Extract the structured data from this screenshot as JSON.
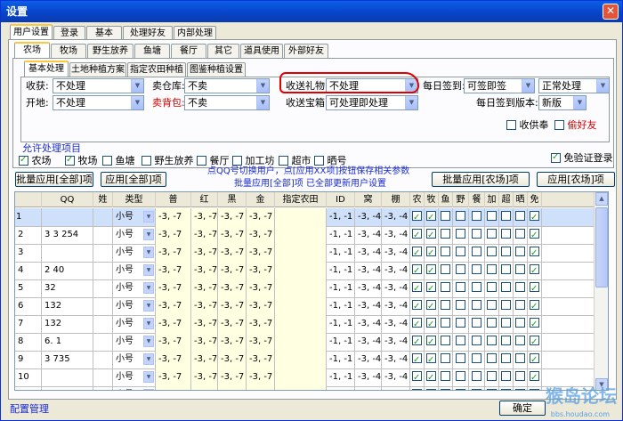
{
  "window": {
    "title": "设置",
    "close": "✕"
  },
  "main_tabs": [
    "用户设置",
    "登录",
    "基本",
    "处理好友",
    "内部处理"
  ],
  "sub_tabs": [
    "农场",
    "牧场",
    "野生放养",
    "鱼塘",
    "餐厅",
    "其它",
    "道具使用",
    "外部好友"
  ],
  "inner_tabs": [
    "基本处理",
    "土地种植方案",
    "指定农田种植",
    "图鉴种植设置"
  ],
  "form": {
    "harvest": {
      "label": "收获:",
      "value": "不处理"
    },
    "warehouse_sell": {
      "label": "卖仓库:",
      "value": "不卖"
    },
    "gift": {
      "label": "收送礼物:",
      "value": "不处理"
    },
    "daily_sign": {
      "label": "每日签到:",
      "value": "可签即签"
    },
    "normal": {
      "value": "正常处理"
    },
    "open_land": {
      "label": "开地:",
      "value": "不处理"
    },
    "bag_sell": {
      "label": "卖背包:",
      "value": "不卖"
    },
    "treasure": {
      "label": "收送宝箱:",
      "value": "可处理即处理"
    },
    "sign_version": {
      "label": "每日签到版本:",
      "value": "新版"
    },
    "collect_fist": {
      "label": "收供奉",
      "checked": false
    },
    "steal_friend": {
      "label": "偷好友",
      "checked": false
    }
  },
  "allow": {
    "title": "允许处理项目",
    "items": [
      {
        "label": "农场",
        "checked": true
      },
      {
        "label": "牧场",
        "checked": true
      },
      {
        "label": "鱼塘",
        "checked": false
      },
      {
        "label": "野生放养",
        "checked": false
      },
      {
        "label": "餐厅",
        "checked": false
      },
      {
        "label": "加工坊",
        "checked": false
      },
      {
        "label": "超市",
        "checked": false
      },
      {
        "label": "晒号",
        "checked": false
      }
    ],
    "free_verify": {
      "label": "免验证登录",
      "checked": true
    }
  },
  "hint1": "点QQ号切换用户，点[应用XX项]按钮保存相关参数",
  "hint2": "批量应用[全部]项 已全部更新用户设置",
  "buttons": {
    "batch_all": "批量应用[全部]项",
    "apply_all": "应用[全部]项",
    "batch_farm": "批量应用[农场]项",
    "apply_farm": "应用[农场]项",
    "ok": "确定"
  },
  "table": {
    "headers": [
      "QQ",
      "姓",
      "类型",
      "普",
      "红",
      "黑",
      "金",
      "指定农田",
      "ID",
      "窝",
      "棚",
      "农",
      "牧",
      "鱼",
      "野",
      "餐",
      "加",
      "超",
      "晒",
      "免"
    ],
    "rows": [
      {
        "n": "1",
        "qq": "",
        "type": "小号",
        "v": "-3, -7",
        "id": "-1, -1",
        "w": "-3, -4",
        "c": "-3, -4",
        "cur": true
      },
      {
        "n": "2",
        "qq": "3  3  254",
        "type": "小号",
        "v": "-3, -7",
        "id": "-1, -1",
        "w": "-3, -4",
        "c": "-3, -4"
      },
      {
        "n": "3",
        "qq": "",
        "type": "小号",
        "v": "-3, -7",
        "id": "-1, -1",
        "w": "-3, -4",
        "c": "-3, -4"
      },
      {
        "n": "4",
        "qq": "2 40",
        "type": "小号",
        "v": "-3, -7",
        "id": "-1, -1",
        "w": "-3, -4",
        "c": "-3, -4"
      },
      {
        "n": "5",
        "qq": "32",
        "type": "小号",
        "v": "-3, -7",
        "id": "-1, -1",
        "w": "-3, -4",
        "c": "-3, -4"
      },
      {
        "n": "6",
        "qq": "132",
        "type": "小号",
        "v": "-3, -7",
        "id": "-1, -1",
        "w": "-3, -4",
        "c": "-3, -4"
      },
      {
        "n": "7",
        "qq": "132",
        "type": "小号",
        "v": "-3, -7",
        "id": "-1, -1",
        "w": "-3, -4",
        "c": "-3, -4"
      },
      {
        "n": "8",
        "qq": "6. 1",
        "type": "小号",
        "v": "-3, -7",
        "id": "-1, -1",
        "w": "-3, -4",
        "c": "-3, -4"
      },
      {
        "n": "9",
        "qq": "3  735",
        "type": "小号",
        "v": "-3, -7",
        "id": "-1, -1",
        "w": "-3, -4",
        "c": "-3, -4"
      },
      {
        "n": "10",
        "qq": "",
        "type": "小号",
        "v": "-3, -7",
        "id": "-1, -1",
        "w": "-3, -4",
        "c": "-3, -4"
      },
      {
        "n": "11",
        "qq": "1",
        "type": "小号",
        "v": "-3, -7",
        "id": "-1, -1",
        "w": "-3, -4",
        "c": "-3, -4"
      }
    ]
  },
  "footer": {
    "link": "配置管理"
  },
  "watermark": {
    "main": "猴岛论坛",
    "sub": "bbs.houdao.com"
  }
}
